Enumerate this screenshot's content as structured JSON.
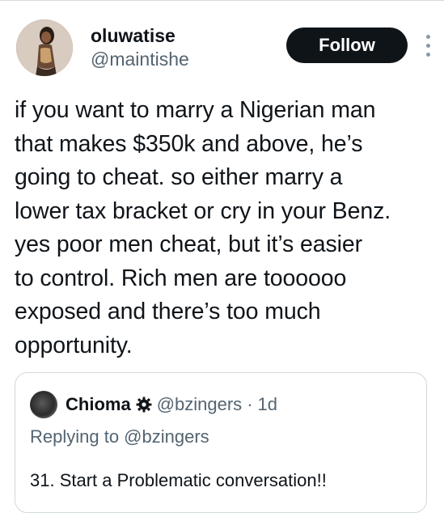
{
  "author": {
    "display_name": "oluwatise",
    "handle": "@maintishe",
    "avatar_icon": "profile-photo-icon"
  },
  "actions": {
    "follow_label": "Follow",
    "more_icon": "vertical-ellipsis-icon"
  },
  "tweet": {
    "text": "if you want to marry a Nigerian man\nthat makes $350k and above, he’s\ngoing to cheat. so either marry a\nlower tax bracket or cry in your Benz.\nyes poor men cheat, but it’s easier\nto control. Rich men are toooooo\nexposed and there’s too much\nopportunity."
  },
  "quoted": {
    "display_name": "Chioma",
    "verified_icon": "gear-badge-icon",
    "handle": "@bzingers",
    "separator": "·",
    "time": "1d",
    "replying_to": "Replying to @bzingers",
    "text": "31. Start a Problematic conversation!!"
  },
  "colors": {
    "primary_text": "#0f1419",
    "secondary_text": "#536471",
    "button_bg": "#0f1419",
    "border": "#cfd9de"
  }
}
